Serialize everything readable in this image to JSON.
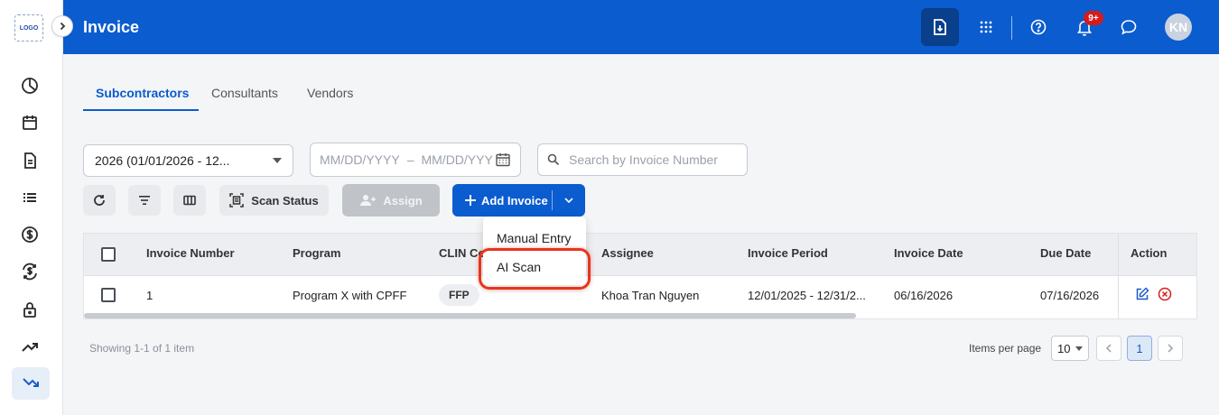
{
  "header": {
    "title": "Invoice",
    "notification_badge": "9+",
    "avatar_initials": "KN"
  },
  "logo_text": "LOGO",
  "tabs": [
    {
      "label": "Subcontractors",
      "active": true
    },
    {
      "label": "Consultants",
      "active": false
    },
    {
      "label": "Vendors",
      "active": false
    }
  ],
  "filters": {
    "period_select": "2026 (01/01/2026 - 12...",
    "date_start_placeholder": "MM/DD/YYYY",
    "date_separator": "–",
    "date_end_placeholder": "MM/DD/YYY",
    "search_placeholder": "Search by Invoice Number"
  },
  "toolbar": {
    "scan_status_label": "Scan Status",
    "assign_label": "Assign",
    "add_invoice_label": "Add Invoice"
  },
  "dropdown": {
    "items": [
      "Manual Entry",
      "AI Scan"
    ]
  },
  "table": {
    "columns": [
      "Invoice Number",
      "Program",
      "CLIN Co",
      "Assignee",
      "Invoice Period",
      "Invoice Date",
      "Due Date",
      "Action"
    ],
    "rows": [
      {
        "invoice_number": "1",
        "program": "Program X with CPFF",
        "clin": "FFP",
        "assignee": "Khoa Tran Nguyen",
        "invoice_period": "12/01/2025 - 12/31/2...",
        "invoice_date": "06/16/2026",
        "due_date": "07/16/2026"
      }
    ]
  },
  "footer": {
    "showing": "Showing 1-1 of 1 item",
    "items_per_page_label": "Items per page",
    "items_per_page_value": "10",
    "current_page": "1"
  },
  "colors": {
    "brand": "#0a5ccf",
    "highlight": "#e8341c",
    "badge": "#d71a1a"
  }
}
